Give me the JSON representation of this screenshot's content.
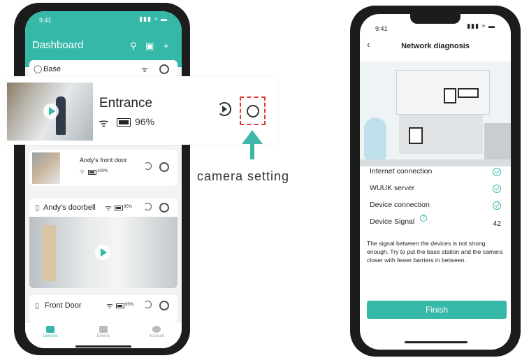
{
  "left_phone": {
    "status_time": "9:41",
    "status_icons": "▮▮▮ ≈ ▬",
    "title": "Dashboard",
    "header_icons": [
      "hub-icon",
      "qr-icon",
      "plus-icon"
    ],
    "base_card": {
      "title": "Base"
    },
    "front_door_card": {
      "title": "Andy's front door",
      "battery": "100%"
    },
    "doorbell_card": {
      "title": "Andy's doorbell",
      "battery": "95%"
    },
    "front_door2_card": {
      "title": "Front Door",
      "battery": "95%"
    },
    "nav": {
      "devices": "Devices",
      "events": "Events",
      "account": "Account"
    }
  },
  "zoom": {
    "title": "Entrance",
    "battery": "96%"
  },
  "callout": {
    "label": "camera setting"
  },
  "right_phone": {
    "status_time": "9:41",
    "status_icons": "▮▮▮ ≈ ▬",
    "back": "‹",
    "title": "Network diagnosis",
    "rows": [
      {
        "label": "Internet connection"
      },
      {
        "label": "WUUK server"
      },
      {
        "label": "Device connection"
      },
      {
        "label": "Device Signal",
        "value": "42"
      }
    ],
    "note": "The signal between the devices is not strong enough. Try to put the base station and the camera closer with fewer barriers in between.",
    "button": "Finish"
  },
  "colors": {
    "accent": "#36b8a9",
    "highlight": "#e53935",
    "arrow": "#3fb6a8"
  }
}
